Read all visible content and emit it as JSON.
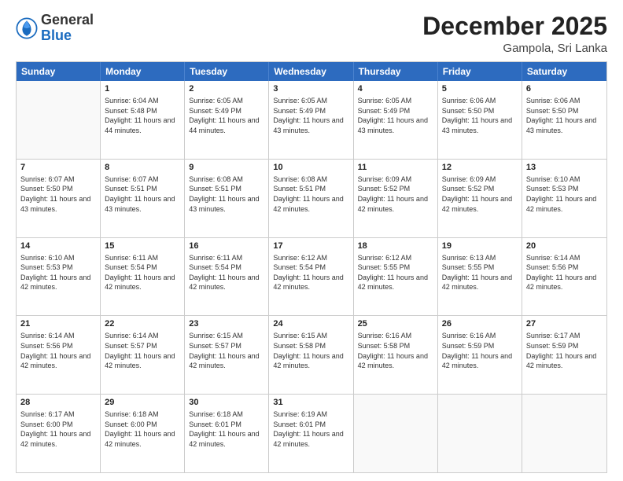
{
  "logo": {
    "general": "General",
    "blue": "Blue"
  },
  "title": "December 2025",
  "location": "Gampola, Sri Lanka",
  "days": [
    "Sunday",
    "Monday",
    "Tuesday",
    "Wednesday",
    "Thursday",
    "Friday",
    "Saturday"
  ],
  "rows": [
    [
      {
        "day": "",
        "empty": true
      },
      {
        "day": "1",
        "sunrise": "Sunrise: 6:04 AM",
        "sunset": "Sunset: 5:48 PM",
        "daylight": "Daylight: 11 hours and 44 minutes."
      },
      {
        "day": "2",
        "sunrise": "Sunrise: 6:05 AM",
        "sunset": "Sunset: 5:49 PM",
        "daylight": "Daylight: 11 hours and 44 minutes."
      },
      {
        "day": "3",
        "sunrise": "Sunrise: 6:05 AM",
        "sunset": "Sunset: 5:49 PM",
        "daylight": "Daylight: 11 hours and 43 minutes."
      },
      {
        "day": "4",
        "sunrise": "Sunrise: 6:05 AM",
        "sunset": "Sunset: 5:49 PM",
        "daylight": "Daylight: 11 hours and 43 minutes."
      },
      {
        "day": "5",
        "sunrise": "Sunrise: 6:06 AM",
        "sunset": "Sunset: 5:50 PM",
        "daylight": "Daylight: 11 hours and 43 minutes."
      },
      {
        "day": "6",
        "sunrise": "Sunrise: 6:06 AM",
        "sunset": "Sunset: 5:50 PM",
        "daylight": "Daylight: 11 hours and 43 minutes."
      }
    ],
    [
      {
        "day": "7",
        "sunrise": "Sunrise: 6:07 AM",
        "sunset": "Sunset: 5:50 PM",
        "daylight": "Daylight: 11 hours and 43 minutes."
      },
      {
        "day": "8",
        "sunrise": "Sunrise: 6:07 AM",
        "sunset": "Sunset: 5:51 PM",
        "daylight": "Daylight: 11 hours and 43 minutes."
      },
      {
        "day": "9",
        "sunrise": "Sunrise: 6:08 AM",
        "sunset": "Sunset: 5:51 PM",
        "daylight": "Daylight: 11 hours and 43 minutes."
      },
      {
        "day": "10",
        "sunrise": "Sunrise: 6:08 AM",
        "sunset": "Sunset: 5:51 PM",
        "daylight": "Daylight: 11 hours and 42 minutes."
      },
      {
        "day": "11",
        "sunrise": "Sunrise: 6:09 AM",
        "sunset": "Sunset: 5:52 PM",
        "daylight": "Daylight: 11 hours and 42 minutes."
      },
      {
        "day": "12",
        "sunrise": "Sunrise: 6:09 AM",
        "sunset": "Sunset: 5:52 PM",
        "daylight": "Daylight: 11 hours and 42 minutes."
      },
      {
        "day": "13",
        "sunrise": "Sunrise: 6:10 AM",
        "sunset": "Sunset: 5:53 PM",
        "daylight": "Daylight: 11 hours and 42 minutes."
      }
    ],
    [
      {
        "day": "14",
        "sunrise": "Sunrise: 6:10 AM",
        "sunset": "Sunset: 5:53 PM",
        "daylight": "Daylight: 11 hours and 42 minutes."
      },
      {
        "day": "15",
        "sunrise": "Sunrise: 6:11 AM",
        "sunset": "Sunset: 5:54 PM",
        "daylight": "Daylight: 11 hours and 42 minutes."
      },
      {
        "day": "16",
        "sunrise": "Sunrise: 6:11 AM",
        "sunset": "Sunset: 5:54 PM",
        "daylight": "Daylight: 11 hours and 42 minutes."
      },
      {
        "day": "17",
        "sunrise": "Sunrise: 6:12 AM",
        "sunset": "Sunset: 5:54 PM",
        "daylight": "Daylight: 11 hours and 42 minutes."
      },
      {
        "day": "18",
        "sunrise": "Sunrise: 6:12 AM",
        "sunset": "Sunset: 5:55 PM",
        "daylight": "Daylight: 11 hours and 42 minutes."
      },
      {
        "day": "19",
        "sunrise": "Sunrise: 6:13 AM",
        "sunset": "Sunset: 5:55 PM",
        "daylight": "Daylight: 11 hours and 42 minutes."
      },
      {
        "day": "20",
        "sunrise": "Sunrise: 6:14 AM",
        "sunset": "Sunset: 5:56 PM",
        "daylight": "Daylight: 11 hours and 42 minutes."
      }
    ],
    [
      {
        "day": "21",
        "sunrise": "Sunrise: 6:14 AM",
        "sunset": "Sunset: 5:56 PM",
        "daylight": "Daylight: 11 hours and 42 minutes."
      },
      {
        "day": "22",
        "sunrise": "Sunrise: 6:14 AM",
        "sunset": "Sunset: 5:57 PM",
        "daylight": "Daylight: 11 hours and 42 minutes."
      },
      {
        "day": "23",
        "sunrise": "Sunrise: 6:15 AM",
        "sunset": "Sunset: 5:57 PM",
        "daylight": "Daylight: 11 hours and 42 minutes."
      },
      {
        "day": "24",
        "sunrise": "Sunrise: 6:15 AM",
        "sunset": "Sunset: 5:58 PM",
        "daylight": "Daylight: 11 hours and 42 minutes."
      },
      {
        "day": "25",
        "sunrise": "Sunrise: 6:16 AM",
        "sunset": "Sunset: 5:58 PM",
        "daylight": "Daylight: 11 hours and 42 minutes."
      },
      {
        "day": "26",
        "sunrise": "Sunrise: 6:16 AM",
        "sunset": "Sunset: 5:59 PM",
        "daylight": "Daylight: 11 hours and 42 minutes."
      },
      {
        "day": "27",
        "sunrise": "Sunrise: 6:17 AM",
        "sunset": "Sunset: 5:59 PM",
        "daylight": "Daylight: 11 hours and 42 minutes."
      }
    ],
    [
      {
        "day": "28",
        "sunrise": "Sunrise: 6:17 AM",
        "sunset": "Sunset: 6:00 PM",
        "daylight": "Daylight: 11 hours and 42 minutes."
      },
      {
        "day": "29",
        "sunrise": "Sunrise: 6:18 AM",
        "sunset": "Sunset: 6:00 PM",
        "daylight": "Daylight: 11 hours and 42 minutes."
      },
      {
        "day": "30",
        "sunrise": "Sunrise: 6:18 AM",
        "sunset": "Sunset: 6:01 PM",
        "daylight": "Daylight: 11 hours and 42 minutes."
      },
      {
        "day": "31",
        "sunrise": "Sunrise: 6:19 AM",
        "sunset": "Sunset: 6:01 PM",
        "daylight": "Daylight: 11 hours and 42 minutes."
      },
      {
        "day": "",
        "empty": true
      },
      {
        "day": "",
        "empty": true
      },
      {
        "day": "",
        "empty": true
      }
    ]
  ]
}
